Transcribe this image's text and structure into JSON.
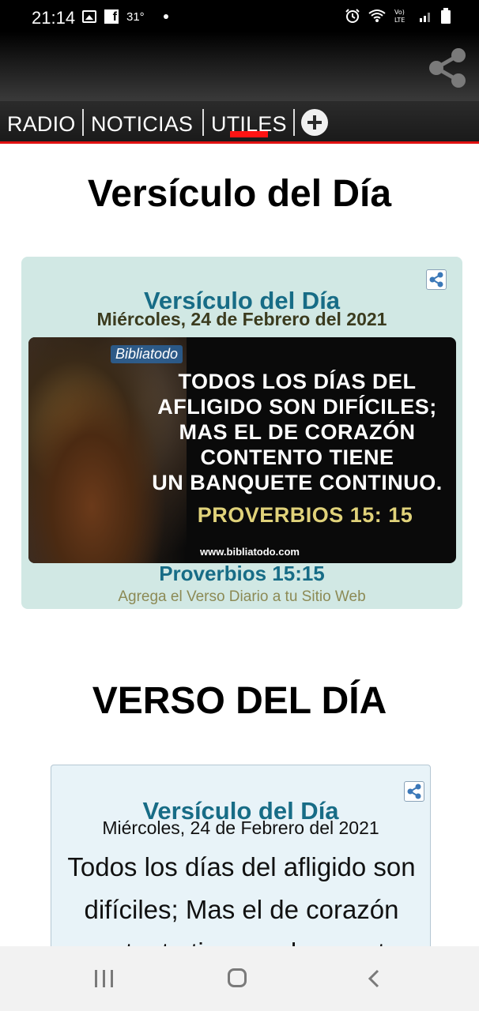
{
  "status_bar": {
    "time": "21:14",
    "temperature": "31°",
    "icons": [
      "gallery-icon",
      "facebook-icon",
      "alarm-icon",
      "wifi-icon",
      "volte-icon",
      "signal-icon",
      "battery-icon"
    ],
    "volte_label": "Vo) LTE"
  },
  "header": {
    "share_icon": "share-icon"
  },
  "tabs": [
    {
      "label": "RADIO",
      "active": false
    },
    {
      "label": "NOTICIAS",
      "active": false
    },
    {
      "label": "UTILES",
      "active": true
    }
  ],
  "accent_color": "#e01010",
  "section1": {
    "heading": "Versículo del Día",
    "card": {
      "title": "Versículo del Día",
      "date": "Miércoles, 24 de Febrero del 2021",
      "image": {
        "logo": "Bibliatodo",
        "lines": [
          "TODOS LOS DÍAS DEL",
          "AFLIGIDO SON DIFÍCILES;",
          "MAS EL DE CORAZÓN",
          "CONTENTO TIENE",
          "UN BANQUETE CONTINUO."
        ],
        "reference": "PROVERBIOS 15: 15",
        "url": "www.bibliatodo.com"
      },
      "reference": "Proverbios 15:15",
      "link": "Agrega el Verso Diario a tu Sitio Web"
    }
  },
  "section2": {
    "heading": "VERSO DEL DÍA",
    "card": {
      "title": "Versículo del Día",
      "date": "Miércoles, 24 de Febrero del 2021",
      "text": "Todos los días del afligido son difíciles; Mas el de corazón contento tiene un banquete continuo."
    }
  }
}
